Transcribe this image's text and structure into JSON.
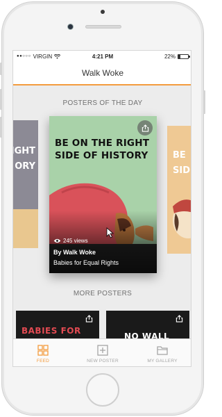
{
  "status_bar": {
    "carrier": "VIRGIN",
    "time": "4:21 PM",
    "battery": "22%",
    "battery_level": 0.22
  },
  "header": {
    "title": "Walk Woke"
  },
  "sections": {
    "posters_of_day": "POSTERS OF THE DAY",
    "more_posters": "MORE POSTERS"
  },
  "featured_poster": {
    "headline": "BE ON THE RIGHT SIDE OF HISTORY",
    "views": "245 views",
    "author": "By Walk Woke",
    "title": "Babies for Equal Rights",
    "share_icon": "share-icon"
  },
  "side_posters": {
    "left_text": "IGHT\nORY",
    "right_text": "BE\nSID"
  },
  "more_posters": [
    {
      "text": "BABIES FOR",
      "share_icon": "share-icon"
    },
    {
      "text": "NO WALL",
      "share_icon": "share-icon"
    }
  ],
  "tabs": [
    {
      "label": "FEED",
      "icon": "grid-icon",
      "active": true
    },
    {
      "label": "NEW POSTER",
      "icon": "plus-square-icon",
      "active": false
    },
    {
      "label": "MY GALLERY",
      "icon": "folder-icon",
      "active": false
    }
  ],
  "colors": {
    "accent": "#f39b3d",
    "poster_green": "#a9d2a9",
    "poster_red": "#d9525a"
  }
}
